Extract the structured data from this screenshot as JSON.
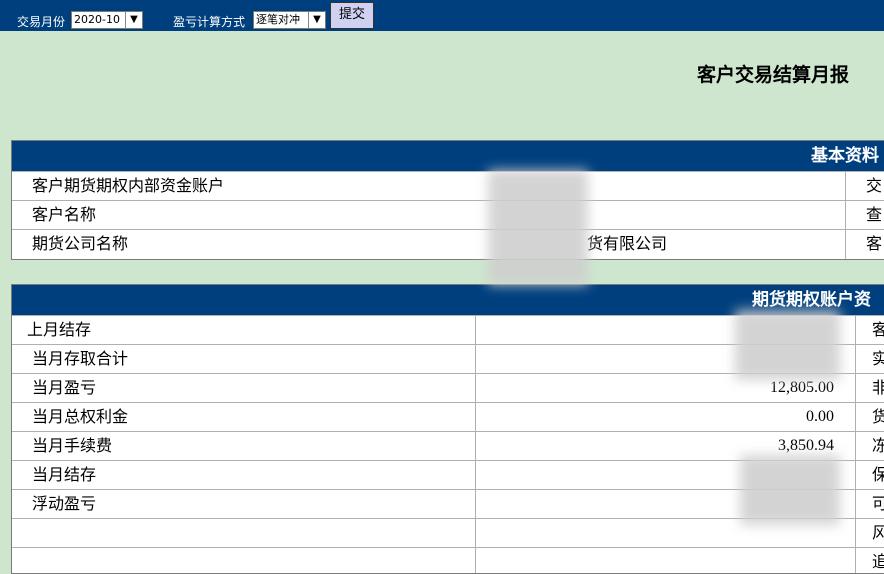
{
  "toolbar": {
    "month_label": "交易月份",
    "month_value": "2020-10",
    "method_label": "盈亏计算方式",
    "method_value": "逐笔对冲",
    "submit_label": "提交"
  },
  "report_title": "客户交易结算月报",
  "basic_info": {
    "header": "基本资料",
    "rows": [
      {
        "label": "客户期货期权内部资金账户",
        "value": "",
        "right": "交"
      },
      {
        "label": "客户名称",
        "value": "",
        "right": "查"
      },
      {
        "label": "期货公司名称",
        "value": "货有限公司",
        "right": "客"
      }
    ]
  },
  "account": {
    "header": "期货期权账户资",
    "rows": [
      {
        "label": "上月结存",
        "value": "",
        "right": "客"
      },
      {
        "label": "当月存取合计",
        "value": "",
        "right": "实"
      },
      {
        "label": "当月盈亏",
        "value": "12,805.00",
        "right": "非"
      },
      {
        "label": "当月总权利金",
        "value": "0.00",
        "right": "货"
      },
      {
        "label": "当月手续费",
        "value": "3,850.94",
        "right": "冻"
      },
      {
        "label": "当月结存",
        "value": "",
        "right": "保"
      },
      {
        "label": "浮动盈亏",
        "value": "",
        "right": "可"
      },
      {
        "label": "",
        "value": "",
        "right": "风"
      },
      {
        "label": "",
        "value": "",
        "right": "追"
      }
    ]
  }
}
